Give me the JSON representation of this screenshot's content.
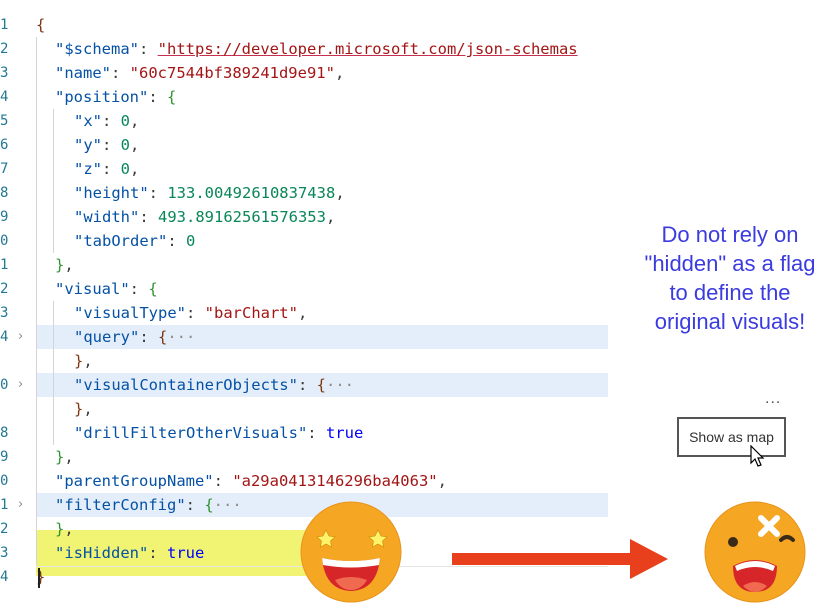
{
  "editor": {
    "lines": [
      {
        "num": "1",
        "parts": [
          [
            "br2",
            "{"
          ]
        ]
      },
      {
        "num": "2",
        "parts": [
          [
            "k",
            "\"$schema\""
          ],
          [
            "p",
            ": "
          ],
          [
            "url",
            "\"https://developer.microsoft.com/json-schemas"
          ]
        ]
      },
      {
        "num": "3",
        "parts": [
          [
            "k",
            "\"name\""
          ],
          [
            "p",
            ": "
          ],
          [
            "s",
            "\"60c7544bf389241d9e91\""
          ],
          [
            "p",
            ","
          ]
        ]
      },
      {
        "num": "4",
        "parts": [
          [
            "k",
            "\"position\""
          ],
          [
            "p",
            ": "
          ],
          [
            "br",
            "{"
          ]
        ]
      },
      {
        "num": "5",
        "parts": [
          [
            "k",
            "\"x\""
          ],
          [
            "p",
            ": "
          ],
          [
            "n",
            "0"
          ],
          [
            "p",
            ","
          ]
        ]
      },
      {
        "num": "6",
        "parts": [
          [
            "k",
            "\"y\""
          ],
          [
            "p",
            ": "
          ],
          [
            "n",
            "0"
          ],
          [
            "p",
            ","
          ]
        ]
      },
      {
        "num": "7",
        "parts": [
          [
            "k",
            "\"z\""
          ],
          [
            "p",
            ": "
          ],
          [
            "n",
            "0"
          ],
          [
            "p",
            ","
          ]
        ]
      },
      {
        "num": "8",
        "parts": [
          [
            "k",
            "\"height\""
          ],
          [
            "p",
            ": "
          ],
          [
            "n",
            "133.00492610837438"
          ],
          [
            "p",
            ","
          ]
        ]
      },
      {
        "num": "9",
        "parts": [
          [
            "k",
            "\"width\""
          ],
          [
            "p",
            ": "
          ],
          [
            "n",
            "493.89162561576353"
          ],
          [
            "p",
            ","
          ]
        ]
      },
      {
        "num": "0",
        "parts": [
          [
            "k",
            "\"tabOrder\""
          ],
          [
            "p",
            ": "
          ],
          [
            "n",
            "0"
          ]
        ]
      },
      {
        "num": "1",
        "parts": [
          [
            "br",
            "}"
          ],
          [
            "p",
            ","
          ]
        ]
      },
      {
        "num": "2",
        "parts": [
          [
            "k",
            "\"visual\""
          ],
          [
            "p",
            ": "
          ],
          [
            "br",
            "{"
          ]
        ]
      },
      {
        "num": "3",
        "parts": [
          [
            "k",
            "\"visualType\""
          ],
          [
            "p",
            ": "
          ],
          [
            "s",
            "\"barChart\""
          ],
          [
            "p",
            ","
          ]
        ]
      },
      {
        "num": "4",
        "parts": [
          [
            "k",
            "\"query\""
          ],
          [
            "p",
            ": "
          ],
          [
            "br2",
            "{"
          ],
          [
            "ell",
            "···"
          ]
        ],
        "folded": true
      },
      {
        "num": "",
        "parts": [
          [
            "br2",
            "}"
          ],
          [
            "p",
            ","
          ]
        ]
      },
      {
        "num": "0",
        "parts": [
          [
            "k",
            "\"visualContainerObjects\""
          ],
          [
            "p",
            ": "
          ],
          [
            "br2",
            "{"
          ],
          [
            "ell",
            "···"
          ]
        ],
        "folded": true
      },
      {
        "num": "",
        "parts": [
          [
            "br2",
            "}"
          ],
          [
            "p",
            ","
          ]
        ]
      },
      {
        "num": "8",
        "parts": [
          [
            "k",
            "\"drillFilterOtherVisuals\""
          ],
          [
            "p",
            ": "
          ],
          [
            "b",
            "true"
          ]
        ]
      },
      {
        "num": "9",
        "parts": [
          [
            "br",
            "}"
          ],
          [
            "p",
            ","
          ]
        ]
      },
      {
        "num": "0",
        "parts": [
          [
            "k",
            "\"parentGroupName\""
          ],
          [
            "p",
            ": "
          ],
          [
            "s",
            "\"a29a0413146296ba4063\""
          ],
          [
            "p",
            ","
          ]
        ]
      },
      {
        "num": "1",
        "parts": [
          [
            "k",
            "\"filterConfig\""
          ],
          [
            "p",
            ": "
          ],
          [
            "br",
            "{"
          ],
          [
            "ell",
            "···"
          ]
        ],
        "folded": true
      },
      {
        "num": "2",
        "parts": [
          [
            "br",
            "}"
          ],
          [
            "p",
            ","
          ]
        ]
      },
      {
        "num": "3",
        "parts": [
          [
            "k",
            "\"isHidden\""
          ],
          [
            "p",
            ": "
          ],
          [
            "b",
            "true"
          ]
        ]
      },
      {
        "num": "4",
        "parts": [
          [
            "br2",
            "}"
          ]
        ]
      }
    ],
    "indents": [
      0,
      1,
      1,
      1,
      2,
      2,
      2,
      2,
      2,
      2,
      1,
      1,
      2,
      2,
      2,
      2,
      2,
      2,
      1,
      1,
      1,
      1,
      1,
      0
    ],
    "fold_chevron": "›"
  },
  "annotation": {
    "note": "Do not rely on \"hidden\" as a flag to define the original visuals!",
    "more_dots": "...",
    "map_button_label": "Show as map"
  },
  "colors": {
    "highlight": "#eef25a",
    "arrow": "#e8401c",
    "emoji_face": "#f5a623",
    "note_text": "#3b3be0"
  }
}
